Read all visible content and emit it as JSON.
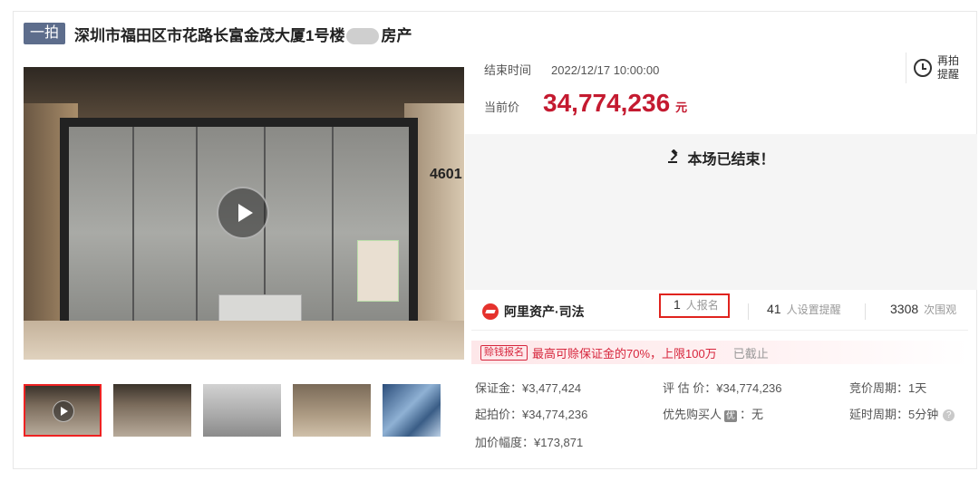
{
  "header": {
    "tag": "一拍",
    "title_prefix": "深圳市福田区市花路长富金茂大厦1号楼",
    "title_suffix": "房产"
  },
  "media": {
    "main_photo_sign": "4601",
    "thumbnail_count": 5
  },
  "auction": {
    "end_time_label": "结束时间",
    "end_time": "2022/12/17 10:00:00",
    "price_label": "当前价",
    "price": "34,774,236",
    "price_unit": "元",
    "remind_label_1": "再拍",
    "remind_label_2": "提醒",
    "ended_text": "本场已结束！"
  },
  "brand": {
    "name": "阿里资产·司法"
  },
  "stats": {
    "signups": "1",
    "signups_label": "人报名",
    "reminders": "41",
    "reminders_label": "人设置提醒",
    "views": "3308",
    "views_label": "次围观"
  },
  "promo": {
    "tag": "赊钱报名",
    "text": "最高可赊保证金的70%，上限100万",
    "status": "已截止"
  },
  "details": {
    "deposit": "保证金：¥3,477,424",
    "appraisal": "评 估 价：¥34,774,236",
    "bid_cycle": "竞价周期：1天",
    "start_price": "起拍价：¥34,774,236",
    "priority_label": "优先购买人",
    "priority_badge": "优",
    "priority_value": "：无",
    "delay_cycle": "延时周期：5分钟",
    "increment": "加价幅度：¥173,871"
  },
  "colors": {
    "price": "#c41a30",
    "accent_red": "#e0231e",
    "tag_bg": "#5d6d8c"
  }
}
